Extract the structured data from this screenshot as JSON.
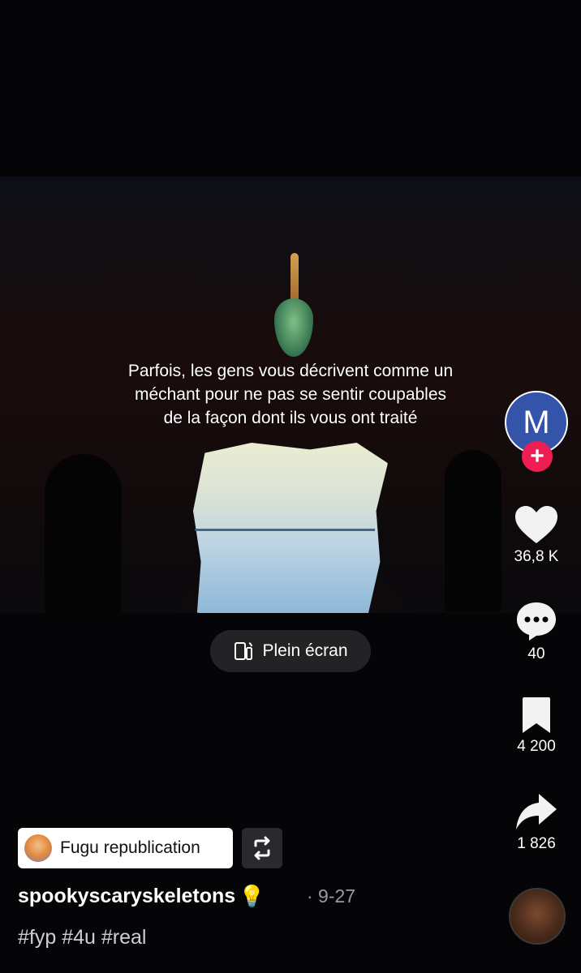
{
  "video": {
    "caption_lines": [
      "Parfois, les gens vous décrivent comme un",
      "méchant pour ne pas se sentir coupables",
      "de la façon dont ils vous ont traité"
    ]
  },
  "fullscreen": {
    "label": "Plein écran"
  },
  "creator": {
    "avatar_letter": "M",
    "follow_badge": "+"
  },
  "actions": {
    "likes": "36,8 K",
    "comments": "40",
    "saves": "4 200",
    "shares": "1 826"
  },
  "repost": {
    "label": "Fugu republication"
  },
  "post": {
    "username": "spookyscaryskeletons",
    "date": "· 9-27",
    "hashtags": "#fyp #4u #real"
  },
  "icons": {
    "like": "heart-icon",
    "comment": "comment-bubble-icon",
    "save": "bookmark-icon",
    "share": "share-arrow-icon",
    "fullscreen": "rotate-screen-icon",
    "repost": "repost-icon",
    "bulb": "lightbulb-icon"
  },
  "colors": {
    "follow_badge": "#ee1d52",
    "avatar_bg": "#3454a9"
  }
}
